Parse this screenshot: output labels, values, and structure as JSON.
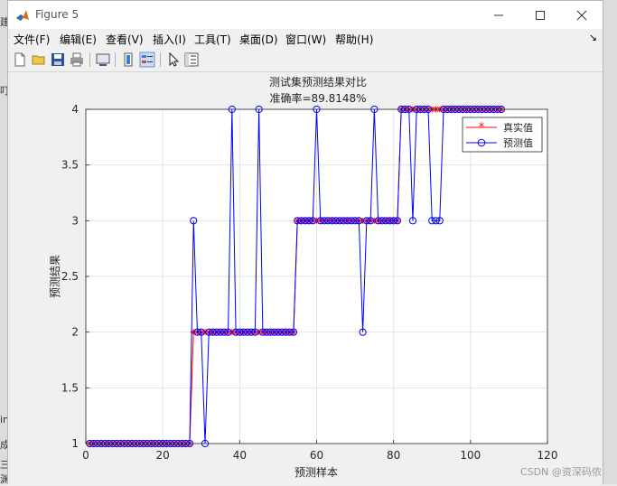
{
  "window": {
    "title": "Figure 5"
  },
  "menu": [
    "文件(F)",
    "编辑(E)",
    "查看(V)",
    "插入(I)",
    "工具(T)",
    "桌面(D)",
    "窗口(W)",
    "帮助(H)"
  ],
  "background_fragments": [
    "建",
    "叮",
    "in",
    "成",
    "三",
    "渊"
  ],
  "plot": {
    "title_line1": "测试集预测结果对比",
    "title_line2": "准确率=89.8148%",
    "xlabel": "预测样本",
    "ylabel": "预测结果",
    "legend": [
      {
        "label": "真实值",
        "color": "#ff0000",
        "marker": "*"
      },
      {
        "label": "预测值",
        "color": "#0000ff",
        "marker": "o"
      }
    ]
  },
  "chart_data": {
    "type": "line",
    "title": "测试集预测结果对比 准确率=89.8148%",
    "xlabel": "预测样本",
    "ylabel": "预测结果",
    "xlim": [
      0,
      120
    ],
    "ylim": [
      1,
      4
    ],
    "xticks": [
      0,
      20,
      40,
      60,
      80,
      100,
      120
    ],
    "yticks": [
      1,
      1.5,
      2,
      2.5,
      3,
      3.5,
      4
    ],
    "xtick_labels": [
      "0",
      "20",
      "40",
      "60",
      "80",
      "100",
      "120"
    ],
    "ytick_labels": [
      "1",
      "1.5",
      "2",
      "2.5",
      "3",
      "3.5",
      "4"
    ],
    "grid": true,
    "legend_position": "top-right",
    "x": [
      1,
      2,
      3,
      4,
      5,
      6,
      7,
      8,
      9,
      10,
      11,
      12,
      13,
      14,
      15,
      16,
      17,
      18,
      19,
      20,
      21,
      22,
      23,
      24,
      25,
      26,
      27,
      28,
      29,
      30,
      31,
      32,
      33,
      34,
      35,
      36,
      37,
      38,
      39,
      40,
      41,
      42,
      43,
      44,
      45,
      46,
      47,
      48,
      49,
      50,
      51,
      52,
      53,
      54,
      55,
      56,
      57,
      58,
      59,
      60,
      61,
      62,
      63,
      64,
      65,
      66,
      67,
      68,
      69,
      70,
      71,
      72,
      73,
      74,
      75,
      76,
      77,
      78,
      79,
      80,
      81,
      82,
      83,
      84,
      85,
      86,
      87,
      88,
      89,
      90,
      91,
      92,
      93,
      94,
      95,
      96,
      97,
      98,
      99,
      100,
      101,
      102,
      103,
      104,
      105,
      106,
      107,
      108
    ],
    "series": [
      {
        "name": "真实值",
        "color": "#ff0000",
        "values": [
          1,
          1,
          1,
          1,
          1,
          1,
          1,
          1,
          1,
          1,
          1,
          1,
          1,
          1,
          1,
          1,
          1,
          1,
          1,
          1,
          1,
          1,
          1,
          1,
          1,
          1,
          1,
          2,
          2,
          2,
          2,
          2,
          2,
          2,
          2,
          2,
          2,
          2,
          2,
          2,
          2,
          2,
          2,
          2,
          2,
          2,
          2,
          2,
          2,
          2,
          2,
          2,
          2,
          2,
          3,
          3,
          3,
          3,
          3,
          3,
          3,
          3,
          3,
          3,
          3,
          3,
          3,
          3,
          3,
          3,
          3,
          3,
          3,
          3,
          3,
          3,
          3,
          3,
          3,
          3,
          3,
          4,
          4,
          4,
          4,
          4,
          4,
          4,
          4,
          4,
          4,
          4,
          4,
          4,
          4,
          4,
          4,
          4,
          4,
          4,
          4,
          4,
          4,
          4,
          4,
          4,
          4,
          4
        ]
      },
      {
        "name": "预测值",
        "color": "#0000ff",
        "values": [
          1,
          1,
          1,
          1,
          1,
          1,
          1,
          1,
          1,
          1,
          1,
          1,
          1,
          1,
          1,
          1,
          1,
          1,
          1,
          1,
          1,
          1,
          1,
          1,
          1,
          1,
          1,
          3,
          2,
          2,
          1,
          2,
          2,
          2,
          2,
          2,
          2,
          4,
          2,
          2,
          2,
          2,
          2,
          2,
          4,
          2,
          2,
          2,
          2,
          2,
          2,
          2,
          2,
          2,
          3,
          3,
          3,
          3,
          3,
          4,
          3,
          3,
          3,
          3,
          3,
          3,
          3,
          3,
          3,
          3,
          3,
          2,
          3,
          3,
          4,
          3,
          3,
          3,
          3,
          3,
          3,
          4,
          4,
          4,
          3,
          4,
          4,
          4,
          4,
          3,
          3,
          3,
          4,
          4,
          4,
          4,
          4,
          4,
          4,
          4,
          4,
          4,
          4,
          4,
          4,
          4,
          4,
          4
        ]
      }
    ]
  },
  "watermark": "CSDN @资深码侬"
}
